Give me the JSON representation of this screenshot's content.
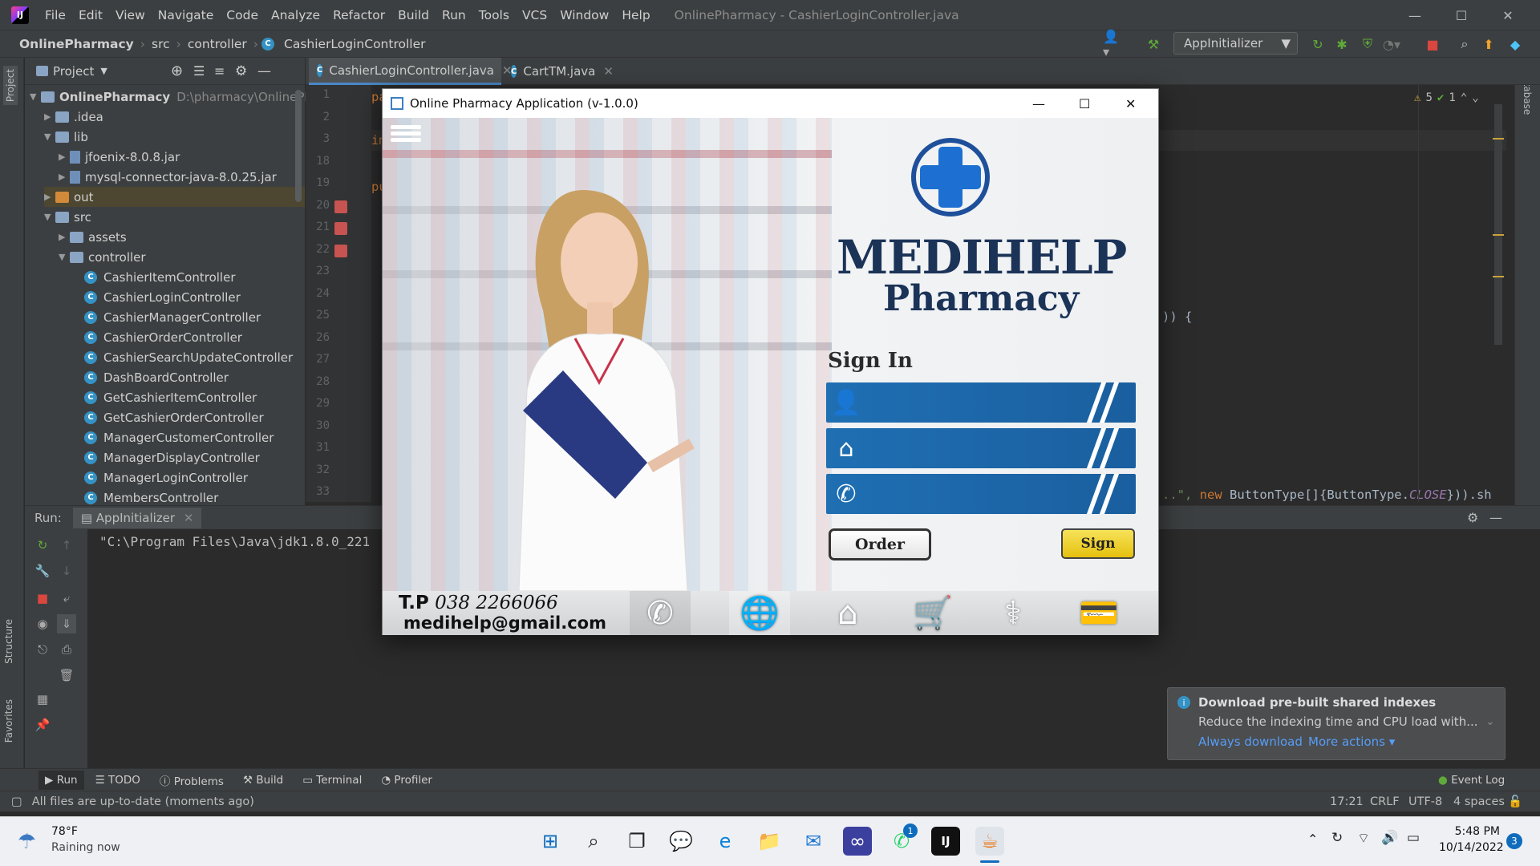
{
  "ide": {
    "logo_text": "IJ",
    "menu": [
      "File",
      "Edit",
      "View",
      "Navigate",
      "Code",
      "Analyze",
      "Refactor",
      "Build",
      "Run",
      "Tools",
      "VCS",
      "Window",
      "Help"
    ],
    "window_title": "OnlinePharmacy - CashierLoginController.java",
    "breadcrumb": [
      "OnlinePharmacy",
      "src",
      "controller",
      "CashierLoginController"
    ],
    "run_config": "AppInitializer",
    "project_panel_label": "Project",
    "project_root": "OnlinePharmacy",
    "project_root_path": "D:\\pharmacy\\OnlinePhar",
    "tree": [
      {
        "label": ".idea",
        "type": "folder",
        "depth": 1,
        "arrow": "▶"
      },
      {
        "label": "lib",
        "type": "folder",
        "depth": 1,
        "arrow": "▼"
      },
      {
        "label": "jfoenix-8.0.8.jar",
        "type": "jar",
        "depth": 2,
        "arrow": "▶"
      },
      {
        "label": "mysql-connector-java-8.0.25.jar",
        "type": "jar",
        "depth": 2,
        "arrow": "▶"
      },
      {
        "label": "out",
        "type": "folder-orange",
        "depth": 1,
        "arrow": "▶"
      },
      {
        "label": "src",
        "type": "folder",
        "depth": 1,
        "arrow": "▼"
      },
      {
        "label": "assets",
        "type": "folder",
        "depth": 2,
        "arrow": "▶"
      },
      {
        "label": "controller",
        "type": "folder",
        "depth": 2,
        "arrow": "▼"
      },
      {
        "label": "CashierItemController",
        "type": "class",
        "depth": 3,
        "arrow": ""
      },
      {
        "label": "CashierLoginController",
        "type": "class",
        "depth": 3,
        "arrow": ""
      },
      {
        "label": "CashierManagerController",
        "type": "class",
        "depth": 3,
        "arrow": ""
      },
      {
        "label": "CashierOrderController",
        "type": "class",
        "depth": 3,
        "arrow": ""
      },
      {
        "label": "CashierSearchUpdateController",
        "type": "class",
        "depth": 3,
        "arrow": ""
      },
      {
        "label": "DashBoardController",
        "type": "class",
        "depth": 3,
        "arrow": ""
      },
      {
        "label": "GetCashierItemController",
        "type": "class",
        "depth": 3,
        "arrow": ""
      },
      {
        "label": "GetCashierOrderController",
        "type": "class",
        "depth": 3,
        "arrow": ""
      },
      {
        "label": "ManagerCustomerController",
        "type": "class",
        "depth": 3,
        "arrow": ""
      },
      {
        "label": "ManagerDisplayController",
        "type": "class",
        "depth": 3,
        "arrow": ""
      },
      {
        "label": "ManagerLoginController",
        "type": "class",
        "depth": 3,
        "arrow": ""
      },
      {
        "label": "MembersController",
        "type": "class",
        "depth": 3,
        "arrow": ""
      }
    ],
    "editor_tabs": [
      "CashierLoginController.java",
      "CartTM.java"
    ],
    "line_numbers": [
      "1",
      "2",
      "3",
      "18",
      "19",
      "20",
      "21",
      "22",
      "23",
      "24",
      "25",
      "26",
      "27",
      "28",
      "29",
      "30",
      "31",
      "32",
      "33"
    ],
    "code_fragments": {
      "l1": "pa",
      "l3": "im",
      "l19": "pu",
      "right1": ")) {",
      "right2_a": "..\", ",
      "right2_new": "new",
      "right2_b": " ButtonType[]{ButtonType.",
      "right2_close": "CLOSE",
      "right2_c": "})).sh"
    },
    "inspections": {
      "warnings": "5",
      "ok": "1"
    },
    "left_strip_labels": [
      "Project",
      "Structure",
      "Favorites"
    ],
    "right_strip_label": "Database",
    "run_label": "Run:",
    "run_tab": "AppInitializer",
    "console_line": "\"C:\\Program Files\\Java\\jdk1.8.0_221",
    "bottom_tabs": [
      "Run",
      "TODO",
      "Problems",
      "Build",
      "Terminal",
      "Profiler"
    ],
    "event_log": "Event Log",
    "status_text": "All files are up-to-date (moments ago)",
    "status_right": [
      "17:21",
      "CRLF",
      "UTF-8",
      "4 spaces"
    ],
    "notification": {
      "title": "Download pre-built shared indexes",
      "body": "Reduce the indexing time and CPU load with...",
      "action1": "Always download",
      "action2": "More actions ▾"
    }
  },
  "app": {
    "window_title": "Online Pharmacy Application (v-1.0.0)",
    "brand_main": "MEDIHELP",
    "brand_sub": "Pharmacy",
    "sign_in_heading": "Sign In",
    "order_button": "Order",
    "sign_button": "Sign",
    "phone_line_prefix": "T.P",
    "phone_number": "038 2266066",
    "email": "medihelp@gmail.com",
    "footer_icons": [
      "phone-icon",
      "globe-icon",
      "home-icon",
      "cart-icon",
      "stethoscope-icon",
      "card-icon"
    ],
    "field_icons": [
      "add-user-icon",
      "home-icon",
      "phone-icon"
    ],
    "accent_blue": "#1a66ab",
    "sign_yellow": "#f0d21a"
  },
  "taskbar": {
    "weather_temp": "78°F",
    "weather_text": "Raining now",
    "time": "5:48 PM",
    "date": "10/14/2022",
    "notifications_count": "3",
    "teams_badge": "1"
  }
}
